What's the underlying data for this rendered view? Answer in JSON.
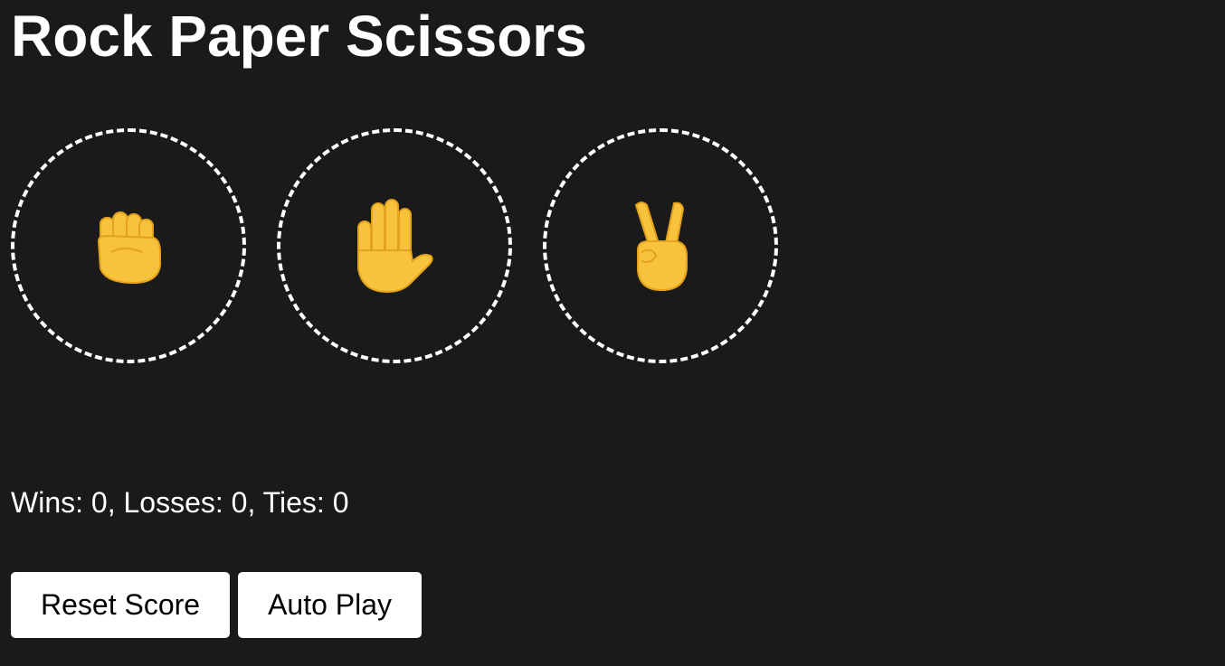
{
  "title": "Rock Paper Scissors",
  "moves": [
    {
      "name": "rock",
      "icon": "raised-fist-icon"
    },
    {
      "name": "paper",
      "icon": "raised-hand-icon"
    },
    {
      "name": "scissors",
      "icon": "victory-hand-icon"
    }
  ],
  "score_text": "Wins: 0, Losses: 0, Ties: 0",
  "score": {
    "wins": 0,
    "losses": 0,
    "ties": 0
  },
  "buttons": {
    "reset_label": "Reset Score",
    "autoplay_label": "Auto Play"
  },
  "colors": {
    "background": "#1a1a1a",
    "text": "#ffffff",
    "emoji_fill": "#f7c23c",
    "emoji_shade": "#e3a21a"
  }
}
